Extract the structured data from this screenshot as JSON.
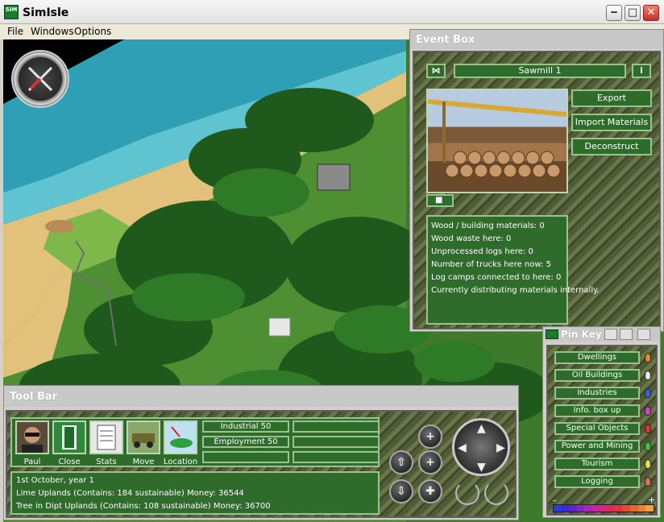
{
  "window": {
    "title": "SimIsle",
    "icon_text": "SIM"
  },
  "menu": [
    "File",
    "Windows",
    "Options"
  ],
  "event_box": {
    "title": "Event Box",
    "building_name": "Sawmill 1",
    "info_button": "i",
    "actions": [
      "Export",
      "Import Materials",
      "Deconstruct"
    ],
    "info_lines": [
      "Wood / building materials: 0",
      "Wood waste here: 0",
      "Unprocessed logs here: 0",
      "Number of trucks here now: 5",
      "Log camps connected to here: 0",
      "Currently distributing materials internally."
    ]
  },
  "pin_key": {
    "title": "Pin Key",
    "minus": "–",
    "plus": "+",
    "items": [
      {
        "label": "Dwellings",
        "color": "#e08a2a"
      },
      {
        "label": "Oil Buildings",
        "color": "#e8e8e8"
      },
      {
        "label": "Industries",
        "color": "#3a5ce0"
      },
      {
        "label": "Info. box up",
        "color": "#d040c8"
      },
      {
        "label": "Special Objects",
        "color": "#e03030"
      },
      {
        "label": "Power and Mining",
        "color": "#40c040"
      },
      {
        "label": "Tourism",
        "color": "#e8e040"
      },
      {
        "label": "Logging",
        "color": "#e07050"
      }
    ],
    "scale_colors": [
      "#2a3ae0",
      "#3a2ad0",
      "#5a2ac8",
      "#8028c0",
      "#a828b0",
      "#c82898",
      "#d8287a",
      "#e02858",
      "#e03838",
      "#e05030",
      "#e06a30",
      "#e88430",
      "#f0a040"
    ]
  },
  "tool_bar": {
    "title": "Tool Bar",
    "tools": [
      "Paul",
      "Close",
      "Stats",
      "Move",
      "Location"
    ],
    "stats": [
      "Industrial 50",
      "Employment 50",
      "",
      "",
      "",
      ""
    ],
    "messages": [
      "1st October, year 1",
      "Lime Uplands (Contains: 184 sustainable)  Money: 36544",
      "Tree in Dipt Uplands (Contains: 108 sustainable)   Money: 36700"
    ]
  },
  "colors": {
    "panel_green": "#2f6b2a",
    "panel_border": "#9ac48e",
    "sea": "#4fb8c6",
    "sand": "#e2c27a"
  }
}
